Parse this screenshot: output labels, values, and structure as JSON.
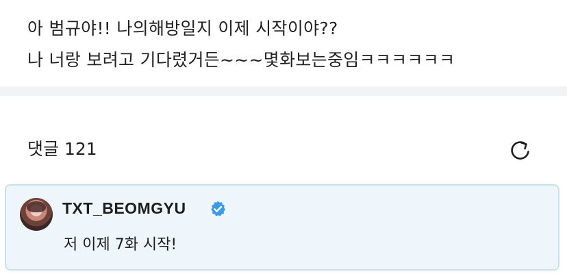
{
  "post": {
    "line1": "아 범규야!! 나의해방일지 이제 시작이야??",
    "line2": "나 너랑 보려고 기다렸거든~~~몇화보는중임ㅋㅋㅋㅋㅋㅋ"
  },
  "comments": {
    "title": "댓글 121",
    "refresh_icon": "refresh-icon"
  },
  "pinned_comment": {
    "username": "TXT_BEOMGYU",
    "verified_icon": "verified-badge-icon",
    "text": "저 이제 7화 시작!",
    "avatar_icon": "user-avatar"
  },
  "colors": {
    "card_background": "#eef6fc",
    "card_border": "#c9e0f1",
    "verified": "#3b9be8",
    "divider": "#f2f3f5"
  }
}
